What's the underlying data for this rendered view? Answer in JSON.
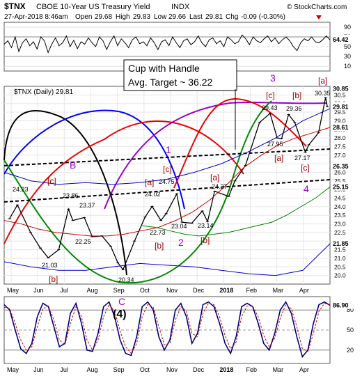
{
  "header": {
    "symbol": "$TNX",
    "name": "CBOE 10-Year US Treasury Yield",
    "exchange": "INDX",
    "date": "27-Apr-2018 8:46am",
    "open_label": "Open",
    "open": "29.68",
    "high_label": "High",
    "high": "29.83",
    "low_label": "Low",
    "low": "29.66",
    "last_label": "Last",
    "last": "29.81",
    "chg_label": "Chg",
    "chg": "-0.09 (-0.30%)",
    "watermark": "© StockCharts.com"
  },
  "colors": {
    "price": "#000000",
    "ma_red": "#cc0000",
    "ma_green": "#008000",
    "ma_blue": "#0000cc",
    "cycle_black": "#000000",
    "cycle_blue": "#0000ff",
    "cycle_red": "#ee0000",
    "cycle_violet": "#9900cc",
    "cycle_green": "#008800",
    "wave_red": "#990000",
    "wave_violet": "#9900cc",
    "rsi": "#000080",
    "stoch": "#000080"
  },
  "chart_data": [
    {
      "type": "line",
      "panel": "top-indicator",
      "title": "",
      "yticks": [
        90,
        70,
        50,
        30,
        10
      ],
      "ylim": [
        0,
        100
      ],
      "last_value_label": "64.42",
      "series": [
        {
          "values": [
            55,
            62,
            48,
            70,
            40,
            58,
            66,
            52,
            60,
            45,
            70,
            62,
            38,
            55,
            68,
            52,
            58,
            72,
            50,
            63,
            46,
            60,
            55,
            68,
            58,
            50,
            70,
            62,
            44,
            60,
            72,
            52,
            66,
            58,
            48,
            64,
            70,
            56,
            60,
            52,
            68,
            58,
            44,
            60,
            64,
            52,
            70,
            58,
            48,
            62,
            66,
            54,
            60,
            72,
            58,
            50,
            64,
            68,
            56,
            62,
            50,
            70,
            64,
            56,
            60,
            74,
            66,
            54,
            70,
            62,
            58,
            66,
            72,
            60,
            68,
            56,
            64,
            70,
            62,
            50,
            42,
            58,
            66,
            62,
            70,
            60,
            58,
            64,
            72,
            64
          ]
        }
      ]
    },
    {
      "type": "line",
      "panel": "price",
      "title": "$TNX (Daily) 29.81",
      "x_labels": [
        "May",
        "Jun",
        "Jul",
        "Aug",
        "Sep",
        "Oct",
        "Nov",
        "Dec",
        "2018",
        "Feb",
        "Mar",
        "Apr"
      ],
      "ylim": [
        19.5,
        31.0
      ],
      "yticks": [
        20.0,
        20.5,
        21.0,
        21.5,
        22.0,
        22.5,
        23.0,
        23.5,
        24.0,
        24.5,
        25.0,
        25.5,
        26.0,
        26.5,
        27.0,
        27.5,
        28.0,
        28.5,
        29.0,
        29.5,
        30.0,
        30.5
      ],
      "last_value_labels": [
        "30.85",
        "29.81",
        "28.61",
        "26.35",
        "25.15",
        "21.85"
      ],
      "series": [
        {
          "name": "$TNX",
          "x": [
            "2017-05-01",
            "2017-05-10",
            "2017-05-25",
            "2017-06-05",
            "2017-06-14",
            "2017-06-26",
            "2017-07-07",
            "2017-07-12",
            "2017-07-25",
            "2017-08-03",
            "2017-08-14",
            "2017-08-24",
            "2017-09-01",
            "2017-09-07",
            "2017-09-20",
            "2017-10-02",
            "2017-10-10",
            "2017-10-20",
            "2017-10-26",
            "2017-11-07",
            "2017-11-13",
            "2017-11-24",
            "2017-12-06",
            "2017-12-12",
            "2017-12-20",
            "2018-01-05",
            "2018-01-12",
            "2018-01-24",
            "2018-02-09",
            "2018-02-21",
            "2018-03-01",
            "2018-03-06",
            "2018-03-14",
            "2018-03-21",
            "2018-04-02",
            "2018-04-06",
            "2018-04-17",
            "2018-04-25",
            "2018-04-27"
          ],
          "values": [
            23.3,
            24.1,
            22.5,
            21.6,
            21.03,
            21.5,
            23.86,
            23.2,
            23.37,
            22.25,
            22.3,
            21.7,
            20.75,
            20.34,
            22.0,
            23.4,
            24.02,
            23.2,
            23.6,
            24.75,
            23.1,
            23.04,
            23.75,
            23.14,
            24.9,
            24.6,
            25.5,
            26.4,
            28.9,
            29.43,
            28.0,
            27.95,
            29.36,
            28.9,
            27.17,
            27.6,
            28.3,
            30.35,
            29.81
          ]
        },
        {
          "name": "MA red",
          "values": [
            23.2,
            23.0,
            22.7,
            22.5,
            22.4,
            22.3,
            22.3,
            22.4,
            22.6,
            22.8,
            23.2,
            23.7,
            24.4,
            25.3,
            26.3,
            27.0,
            27.6,
            28.0,
            28.3,
            28.61
          ]
        },
        {
          "name": "MA green",
          "values": [
            22.9,
            22.8,
            22.6,
            22.4,
            22.3,
            22.4,
            22.5,
            22.7,
            22.9,
            23.1,
            23.5,
            24.0,
            24.5,
            25.15
          ]
        },
        {
          "name": "Env blue upper",
          "values": [
            26.0,
            25.5,
            25.3,
            25.4,
            25.3,
            25.4,
            25.6,
            26.0,
            26.5,
            27.2,
            28.0,
            29.0,
            29.7
          ]
        },
        {
          "name": "Env blue lower",
          "values": [
            20.8,
            20.5,
            20.3,
            20.3,
            20.5,
            20.7,
            20.6,
            20.5,
            20.3,
            20.1,
            20.0,
            20.3,
            21.85
          ]
        }
      ],
      "annotations": [
        {
          "text": "Cup with Handle",
          "kind": "box"
        },
        {
          "text": "Avg. Target ~ 36.22",
          "kind": "box"
        },
        {
          "text": "24.23"
        },
        {
          "text": "23.86"
        },
        {
          "text": "23.37"
        },
        {
          "text": "22.25"
        },
        {
          "text": "21.03"
        },
        {
          "text": "20.34"
        },
        {
          "text": "22.73"
        },
        {
          "text": "24.02"
        },
        {
          "text": "24.75"
        },
        {
          "text": "23.04"
        },
        {
          "text": "24.27"
        },
        {
          "text": "23.14"
        },
        {
          "text": "29.43"
        },
        {
          "text": "27.95"
        },
        {
          "text": "29.36"
        },
        {
          "text": "27.17"
        },
        {
          "text": "30.35"
        },
        {
          "text": "[b]"
        },
        {
          "text": "[c]"
        },
        {
          "text": "B"
        },
        {
          "text": "[a]"
        },
        {
          "text": "[c]"
        },
        {
          "text": "[b]"
        },
        {
          "text": "1"
        },
        {
          "text": "2"
        },
        {
          "text": "[a]"
        },
        {
          "text": "[b]"
        },
        {
          "text": "3"
        },
        {
          "text": "[c]"
        },
        {
          "text": "[b]"
        },
        {
          "text": "[a]"
        },
        {
          "text": "[c]"
        },
        {
          "text": "[a]"
        },
        {
          "text": "4"
        },
        {
          "text": "C"
        },
        {
          "text": "(4)"
        }
      ]
    },
    {
      "type": "line",
      "panel": "bottom-indicator",
      "title": "",
      "x_labels": [
        "May",
        "Jun",
        "Jul",
        "Aug",
        "Sep",
        "Oct",
        "Nov",
        "Dec",
        "2018",
        "Feb",
        "Mar",
        "Apr"
      ],
      "yticks": [
        80,
        50,
        20
      ],
      "ylim": [
        0,
        100
      ],
      "last_value_label": "86.90",
      "series": [
        {
          "name": "fast",
          "values": [
            88,
            80,
            50,
            22,
            15,
            30,
            70,
            90,
            85,
            55,
            25,
            30,
            75,
            90,
            60,
            20,
            18,
            45,
            85,
            92,
            70,
            35,
            15,
            12,
            40,
            85,
            92,
            80,
            40,
            20,
            35,
            80,
            90,
            70,
            30,
            45,
            88,
            92,
            85,
            60,
            30,
            15,
            40,
            85,
            90,
            85,
            60,
            30,
            20,
            45,
            80,
            92,
            75,
            40,
            10,
            20,
            60,
            88,
            92,
            86.9
          ]
        },
        {
          "name": "slow",
          "values": [
            84,
            82,
            60,
            35,
            20,
            25,
            55,
            82,
            86,
            65,
            35,
            28,
            60,
            85,
            70,
            35,
            20,
            35,
            70,
            88,
            78,
            48,
            25,
            15,
            30,
            70,
            88,
            84,
            55,
            28,
            30,
            65,
            85,
            78,
            45,
            40,
            75,
            90,
            88,
            70,
            42,
            22,
            32,
            70,
            86,
            86,
            70,
            42,
            25,
            38,
            68,
            88,
            82,
            55,
            22,
            18,
            45,
            78,
            90,
            88
          ]
        }
      ]
    }
  ]
}
